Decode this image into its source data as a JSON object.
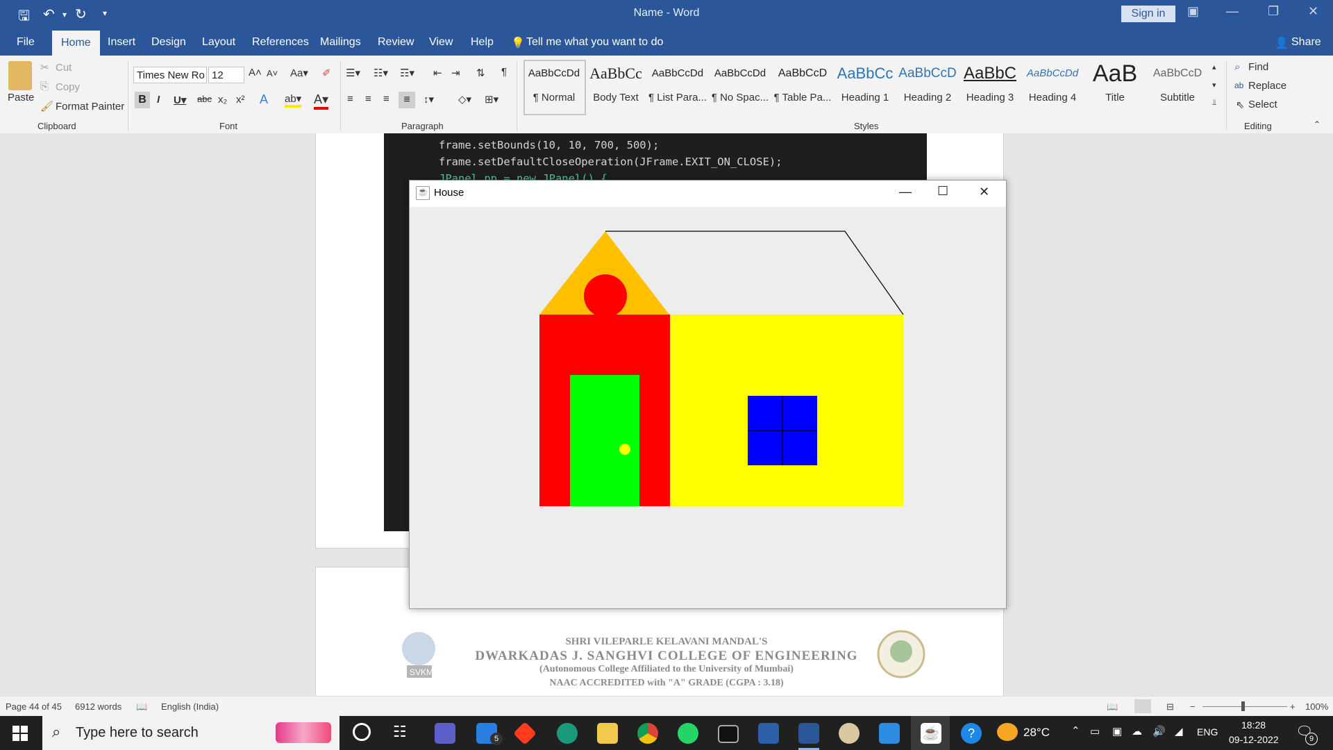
{
  "word": {
    "title": "Name  -  Word",
    "sign_in": "Sign in",
    "share": "Share",
    "tabs": [
      "File",
      "Home",
      "Insert",
      "Design",
      "Layout",
      "References",
      "Mailings",
      "Review",
      "View",
      "Help"
    ],
    "tell_me": "Tell me what you want to do",
    "clipboard": {
      "paste": "Paste",
      "cut": "Cut",
      "copy": "Copy",
      "format_painter": "Format Painter",
      "label": "Clipboard"
    },
    "font": {
      "name": "Times New Ro",
      "size": "12",
      "label": "Font"
    },
    "paragraph": {
      "label": "Paragraph"
    },
    "styles": {
      "label": "Styles",
      "items": [
        {
          "preview": "AaBbCcDd",
          "name": "¶ Normal"
        },
        {
          "preview": "AaBbCc",
          "name": "Body Text"
        },
        {
          "preview": "AaBbCcDd",
          "name": "¶ List Para..."
        },
        {
          "preview": "AaBbCcDd",
          "name": "¶ No Spac..."
        },
        {
          "preview": "AaBbCcD",
          "name": "¶ Table Pa..."
        },
        {
          "preview": "AaBbCc",
          "name": "Heading 1"
        },
        {
          "preview": "AaBbCcD",
          "name": "Heading 2"
        },
        {
          "preview": "AaBbC",
          "name": "Heading 3"
        },
        {
          "preview": "AaBbCcDd",
          "name": "Heading 4"
        },
        {
          "preview": "AaB",
          "name": "Title"
        },
        {
          "preview": "AaBbCcD",
          "name": "Subtitle"
        }
      ]
    },
    "editing": {
      "find": "Find",
      "replace": "Replace",
      "select": "Select",
      "label": "Editing"
    }
  },
  "code_lines": [
    "frame.setBounds(10, 10, 700, 500);",
    "frame.setDefaultCloseOperation(JFrame.EXIT_ON_CLOSE);",
    "JPanel pp = new JPanel() {"
  ],
  "java_window": {
    "title": "House"
  },
  "footer": {
    "line1": "SHRI VILEPARLE KELAVANI MANDAL'S",
    "line2": "DWARKADAS J. SANGHVI COLLEGE OF ENGINEERING",
    "line3": "(Autonomous College Affiliated to the University of Mumbai)",
    "line4": "NAAC ACCREDITED with \"A\" GRADE (CGPA : 3.18)",
    "logo_text": "SVKM"
  },
  "status": {
    "page": "Page 44 of 45",
    "words": "6912 words",
    "language": "English (India)",
    "zoom": "100%"
  },
  "taskbar": {
    "search_placeholder": "Type here to search",
    "temperature": "28°C",
    "lang": "ENG",
    "time": "18:28",
    "date": "09-12-2022",
    "notifications": "9",
    "mail_badge": "5"
  },
  "colors": {
    "accent": "#2b579a",
    "roof": "#ffc000",
    "house_left": "#ff0000",
    "house_right": "#ffff00",
    "door": "#00ff00",
    "window": "#0000ff"
  }
}
